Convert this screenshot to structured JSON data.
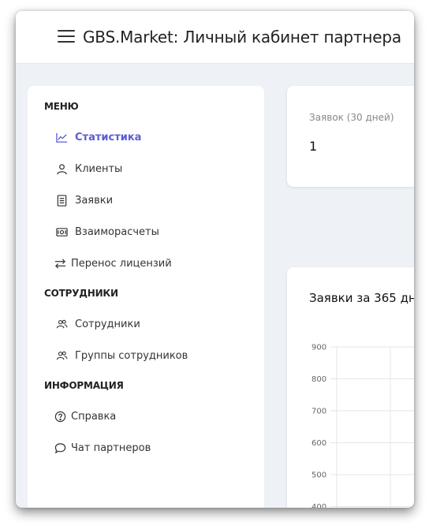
{
  "header": {
    "title": "GBS.Market: Личный кабинет партнера"
  },
  "sidebar": {
    "sections": {
      "menu": "МЕНЮ",
      "staff": "СОТРУДНИКИ",
      "info": "ИНФОРМАЦИЯ"
    },
    "items": [
      {
        "label": "Статистика",
        "icon": "chart-line-icon",
        "active": true
      },
      {
        "label": "Клиенты",
        "icon": "user-icon"
      },
      {
        "label": "Заявки",
        "icon": "document-icon"
      },
      {
        "label": "Взаиморасчеты",
        "icon": "money-icon"
      },
      {
        "label": "Перенос лицензий",
        "icon": "transfer-arrows-icon"
      },
      {
        "label": "Сотрудники",
        "icon": "users-icon"
      },
      {
        "label": "Группы сотрудников",
        "icon": "users-icon"
      },
      {
        "label": "Справка",
        "icon": "help-circle-icon"
      },
      {
        "label": "Чат партнеров",
        "icon": "chat-icon"
      }
    ]
  },
  "stats": {
    "requests_label": "Заявок (30 дней)",
    "requests_value": "1"
  },
  "chart": {
    "title": "Заявки за 365 дн"
  },
  "chart_data": {
    "type": "bar",
    "title": "Заявки за 365 дн",
    "y_ticks": [
      900,
      800,
      700,
      600,
      500,
      400
    ],
    "ylim": [
      400,
      900
    ],
    "grid": true,
    "series": []
  },
  "colors": {
    "accent": "#5b5bd6",
    "background": "#eef1f6",
    "card": "#ffffff"
  }
}
